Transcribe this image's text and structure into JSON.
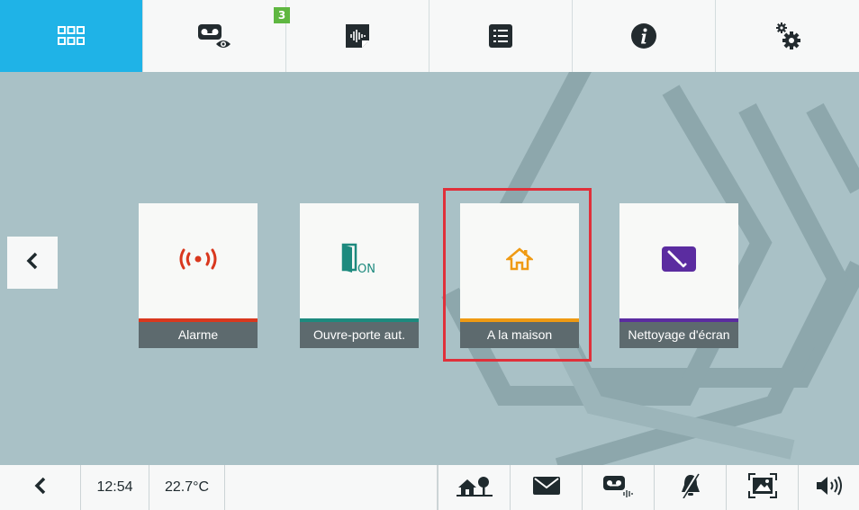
{
  "top_nav": {
    "tabs": [
      {
        "name": "home-grid",
        "icon": "grid-icon",
        "active": true
      },
      {
        "name": "video-messages",
        "icon": "voicemail-eye-icon",
        "badge": "3"
      },
      {
        "name": "audio-messages",
        "icon": "audio-note-icon"
      },
      {
        "name": "list",
        "icon": "list-icon"
      },
      {
        "name": "info",
        "icon": "info-icon"
      },
      {
        "name": "settings",
        "icon": "gears-icon"
      }
    ]
  },
  "cards": [
    {
      "label": "Alarme",
      "icon": "alarm-signal-icon",
      "color": "#d9381e"
    },
    {
      "label": "Ouvre-porte aut.",
      "icon": "door-on-icon",
      "color": "#1d8a7e"
    },
    {
      "label": "A la maison",
      "icon": "house-icon",
      "color": "#ef9a13"
    },
    {
      "label": "Nettoyage d'écran",
      "icon": "screen-clean-icon",
      "color": "#5b2ca0"
    }
  ],
  "status_bar": {
    "time": "12:54",
    "temperature": "22.7°C",
    "icons": [
      "back-arrow-icon",
      "home-tree-icon",
      "mail-icon",
      "voicemail-audio-icon",
      "bell-muted-icon",
      "picture-frame-icon",
      "volume-icon"
    ]
  },
  "colors": {
    "accent": "#1fb3e7",
    "background": "#a9c1c6",
    "highlight": "#e0303a",
    "badge": "#5fb741"
  }
}
